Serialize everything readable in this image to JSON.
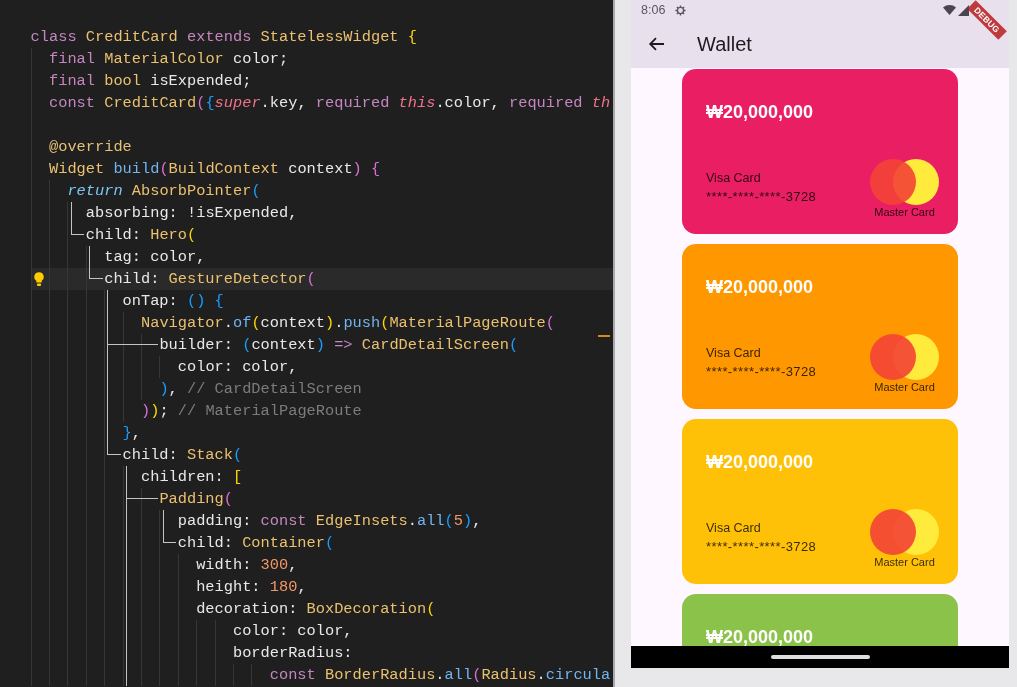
{
  "editor": {
    "lines": [
      {
        "tokens": [
          {
            "text": "class ",
            "kind": "keyword"
          },
          {
            "text": "CreditCard ",
            "kind": "type"
          },
          {
            "text": "extends ",
            "kind": "keyword"
          },
          {
            "text": "StatelessWidget ",
            "kind": "type"
          },
          {
            "text": "{",
            "kind": "brace1"
          }
        ],
        "selected": false
      },
      {
        "tokens": [
          {
            "text": "  final ",
            "kind": "keyword"
          },
          {
            "text": "MaterialColor ",
            "kind": "type"
          },
          {
            "text": "color;",
            "kind": "plain"
          }
        ],
        "selected": false
      },
      {
        "tokens": [
          {
            "text": "  final ",
            "kind": "keyword"
          },
          {
            "text": "bool ",
            "kind": "type"
          },
          {
            "text": "isExpended;",
            "kind": "plain"
          }
        ],
        "selected": false
      },
      {
        "tokens": [
          {
            "text": "  const ",
            "kind": "keyword"
          },
          {
            "text": "CreditCard",
            "kind": "type"
          },
          {
            "text": "(",
            "kind": "brace2"
          },
          {
            "text": "{",
            "kind": "brace3"
          },
          {
            "text": "super",
            "kind": "self"
          },
          {
            "text": ".key, ",
            "kind": "plain"
          },
          {
            "text": "required ",
            "kind": "keyword"
          },
          {
            "text": "this",
            "kind": "self"
          },
          {
            "text": ".color, ",
            "kind": "plain"
          },
          {
            "text": "required ",
            "kind": "keyword"
          },
          {
            "text": "th",
            "kind": "self"
          }
        ],
        "selected": false
      },
      {
        "selected": false
      },
      {
        "tokens": [
          {
            "text": "  @override",
            "kind": "annotation"
          }
        ],
        "selected": false
      },
      {
        "tokens": [
          {
            "text": "  Widget ",
            "kind": "type"
          },
          {
            "text": "build",
            "kind": "method"
          },
          {
            "text": "(",
            "kind": "brace2"
          },
          {
            "text": "BuildContext ",
            "kind": "type"
          },
          {
            "text": "context",
            "kind": "plain"
          },
          {
            "text": ") ",
            "kind": "brace2"
          },
          {
            "text": "{",
            "kind": "brace2"
          }
        ],
        "selected": false
      },
      {
        "tokens": [
          {
            "text": "    return ",
            "kind": "flow"
          },
          {
            "text": "AbsorbPointer",
            "kind": "type"
          },
          {
            "text": "(",
            "kind": "brace3"
          }
        ],
        "selected": false
      },
      {
        "tokens": [
          {
            "text": "      absorbing: !isExpended,",
            "kind": "plain"
          }
        ],
        "outline_guides": [
          {
            "kind": "bar"
          }
        ],
        "selected": false
      },
      {
        "tokens": [
          {
            "text": "      child: ",
            "kind": "plain"
          },
          {
            "text": "Hero",
            "kind": "type"
          },
          {
            "text": "(",
            "kind": "brace1"
          }
        ],
        "outline_guides": [
          {
            "kind": "corner"
          }
        ],
        "selected": false
      },
      {
        "tokens": [
          {
            "text": "        tag: color,",
            "kind": "plain"
          }
        ],
        "outline_guides": [
          {
            "kind": "bar"
          }
        ],
        "selected": false
      },
      {
        "tokens": [
          {
            "text": "        child: ",
            "kind": "plain"
          },
          {
            "text": "GestureDetector",
            "kind": "type"
          },
          {
            "text": "(",
            "kind": "brace2"
          }
        ],
        "outline_guides": [
          {
            "kind": "corner"
          }
        ],
        "selected": true
      },
      {
        "tokens": [
          {
            "text": "          onTap: ",
            "kind": "plain"
          },
          {
            "text": "() {",
            "kind": "brace3"
          }
        ],
        "outline_guides": [
          {
            "kind": "bar"
          }
        ],
        "selected": false
      },
      {
        "tokens": [
          {
            "text": "            Navigator",
            "kind": "type"
          },
          {
            "text": ".",
            "kind": "plain"
          },
          {
            "text": "of",
            "kind": "method"
          },
          {
            "text": "(",
            "kind": "brace1"
          },
          {
            "text": "context",
            "kind": "plain"
          },
          {
            "text": ")",
            "kind": "brace1"
          },
          {
            "text": ".",
            "kind": "plain"
          },
          {
            "text": "push",
            "kind": "method"
          },
          {
            "text": "(",
            "kind": "brace1"
          },
          {
            "text": "MaterialPageRoute",
            "kind": "type"
          },
          {
            "text": "(",
            "kind": "brace2"
          }
        ],
        "outline_guides": [
          {
            "kind": "bar"
          }
        ],
        "selected": false
      },
      {
        "tokens": [
          {
            "text": "              builder: ",
            "kind": "plain"
          },
          {
            "text": "(",
            "kind": "brace3"
          },
          {
            "text": "context",
            "kind": "plain"
          },
          {
            "text": ") ",
            "kind": "brace3"
          },
          {
            "text": "=> ",
            "kind": "keyword"
          },
          {
            "text": "CardDetailScreen",
            "kind": "type"
          },
          {
            "text": "(",
            "kind": "brace3"
          }
        ],
        "outline_guides": [
          {
            "kind": "branch"
          }
        ],
        "selected": false
      },
      {
        "tokens": [
          {
            "text": "                color: color,",
            "kind": "plain"
          }
        ],
        "outline_guides": [
          {
            "kind": "bar"
          }
        ],
        "selected": false
      },
      {
        "tokens": [
          {
            "text": "              )",
            "kind": "brace3"
          },
          {
            "text": ", ",
            "kind": "plain"
          },
          {
            "text": "// CardDetailScreen",
            "kind": "comment"
          }
        ],
        "outline_guides": [
          {
            "kind": "bar"
          }
        ],
        "selected": false
      },
      {
        "tokens": [
          {
            "text": "            )",
            "kind": "brace2"
          },
          {
            "text": ")",
            "kind": "brace1"
          },
          {
            "text": "; ",
            "kind": "plain"
          },
          {
            "text": "// MaterialPageRoute",
            "kind": "comment"
          }
        ],
        "outline_guides": [
          {
            "kind": "bar"
          }
        ],
        "selected": false
      },
      {
        "tokens": [
          {
            "text": "          }",
            "kind": "brace3"
          },
          {
            "text": ",",
            "kind": "plain"
          }
        ],
        "outline_guides": [
          {
            "kind": "bar"
          }
        ],
        "selected": false
      },
      {
        "tokens": [
          {
            "text": "          child: ",
            "kind": "plain"
          },
          {
            "text": "Stack",
            "kind": "type"
          },
          {
            "text": "(",
            "kind": "brace3"
          }
        ],
        "outline_guides": [
          {
            "kind": "corner"
          }
        ],
        "selected": false
      },
      {
        "tokens": [
          {
            "text": "            children: ",
            "kind": "plain"
          },
          {
            "text": "[",
            "kind": "brace1"
          }
        ],
        "outline_guides": [
          {
            "kind": "bar"
          }
        ],
        "selected": false
      },
      {
        "tokens": [
          {
            "text": "              Padding",
            "kind": "type"
          },
          {
            "text": "(",
            "kind": "brace2"
          }
        ],
        "outline_guides": [
          {
            "kind": "branch"
          }
        ],
        "selected": false
      },
      {
        "tokens": [
          {
            "text": "                padding: ",
            "kind": "plain"
          },
          {
            "text": "const ",
            "kind": "keyword"
          },
          {
            "text": "EdgeInsets",
            "kind": "type"
          },
          {
            "text": ".",
            "kind": "plain"
          },
          {
            "text": "all",
            "kind": "method"
          },
          {
            "text": "(",
            "kind": "brace3"
          },
          {
            "text": "5",
            "kind": "number"
          },
          {
            "text": ")",
            "kind": "brace3"
          },
          {
            "text": ",",
            "kind": "plain"
          }
        ],
        "outline_guides": [
          {
            "kind": "bar"
          },
          {
            "kind": "bar"
          }
        ],
        "selected": false
      },
      {
        "tokens": [
          {
            "text": "                child: ",
            "kind": "plain"
          },
          {
            "text": "Container",
            "kind": "type"
          },
          {
            "text": "(",
            "kind": "brace3"
          }
        ],
        "outline_guides": [
          {
            "kind": "bar"
          },
          {
            "kind": "corner"
          }
        ],
        "selected": false
      },
      {
        "tokens": [
          {
            "text": "                  width: ",
            "kind": "plain"
          },
          {
            "text": "300",
            "kind": "number"
          },
          {
            "text": ",",
            "kind": "plain"
          }
        ],
        "outline_guides": [
          {
            "kind": "bar"
          }
        ],
        "selected": false
      },
      {
        "tokens": [
          {
            "text": "                  height: ",
            "kind": "plain"
          },
          {
            "text": "180",
            "kind": "number"
          },
          {
            "text": ",",
            "kind": "plain"
          }
        ],
        "outline_guides": [
          {
            "kind": "bar"
          }
        ],
        "selected": false
      },
      {
        "tokens": [
          {
            "text": "                  decoration: ",
            "kind": "plain"
          },
          {
            "text": "BoxDecoration",
            "kind": "type"
          },
          {
            "text": "(",
            "kind": "brace1"
          }
        ],
        "outline_guides": [
          {
            "kind": "bar"
          }
        ],
        "selected": false
      },
      {
        "tokens": [
          {
            "text": "                      color: color,",
            "kind": "plain"
          }
        ],
        "outline_guides": [
          {
            "kind": "bar"
          }
        ],
        "selected": false
      },
      {
        "tokens": [
          {
            "text": "                      borderRadius:",
            "kind": "plain"
          }
        ],
        "outline_guides": [
          {
            "kind": "bar"
          }
        ],
        "selected": false
      },
      {
        "tokens": [
          {
            "text": "                          const ",
            "kind": "keyword"
          },
          {
            "text": "BorderRadius",
            "kind": "type"
          },
          {
            "text": ".",
            "kind": "plain"
          },
          {
            "text": "all",
            "kind": "method"
          },
          {
            "text": "(",
            "kind": "brace2"
          },
          {
            "text": "Radius",
            "kind": "type"
          },
          {
            "text": ".",
            "kind": "plain"
          },
          {
            "text": "circula",
            "kind": "method"
          }
        ],
        "outline_guides": [
          {
            "kind": "bar"
          }
        ],
        "selected": false
      }
    ]
  },
  "phone": {
    "status_bar": {
      "time": "8:06"
    },
    "debug_banner": "DEBUG",
    "app_bar": {
      "title": "Wallet"
    },
    "cards": [
      {
        "color": "#e91e63",
        "balance": "₩20,000,000",
        "card_type": "Visa Card",
        "number": "****-****-****-3728",
        "brand": "Master Card"
      },
      {
        "color": "#ff9800",
        "balance": "₩20,000,000",
        "card_type": "Visa Card",
        "number": "****-****-****-3728",
        "brand": "Master Card"
      },
      {
        "color": "#ffc107",
        "balance": "₩20,000,000",
        "card_type": "Visa Card",
        "number": "****-****-****-3728",
        "brand": "Master Card"
      },
      {
        "color": "#8bc34a",
        "balance": "₩20,000,000"
      }
    ]
  }
}
